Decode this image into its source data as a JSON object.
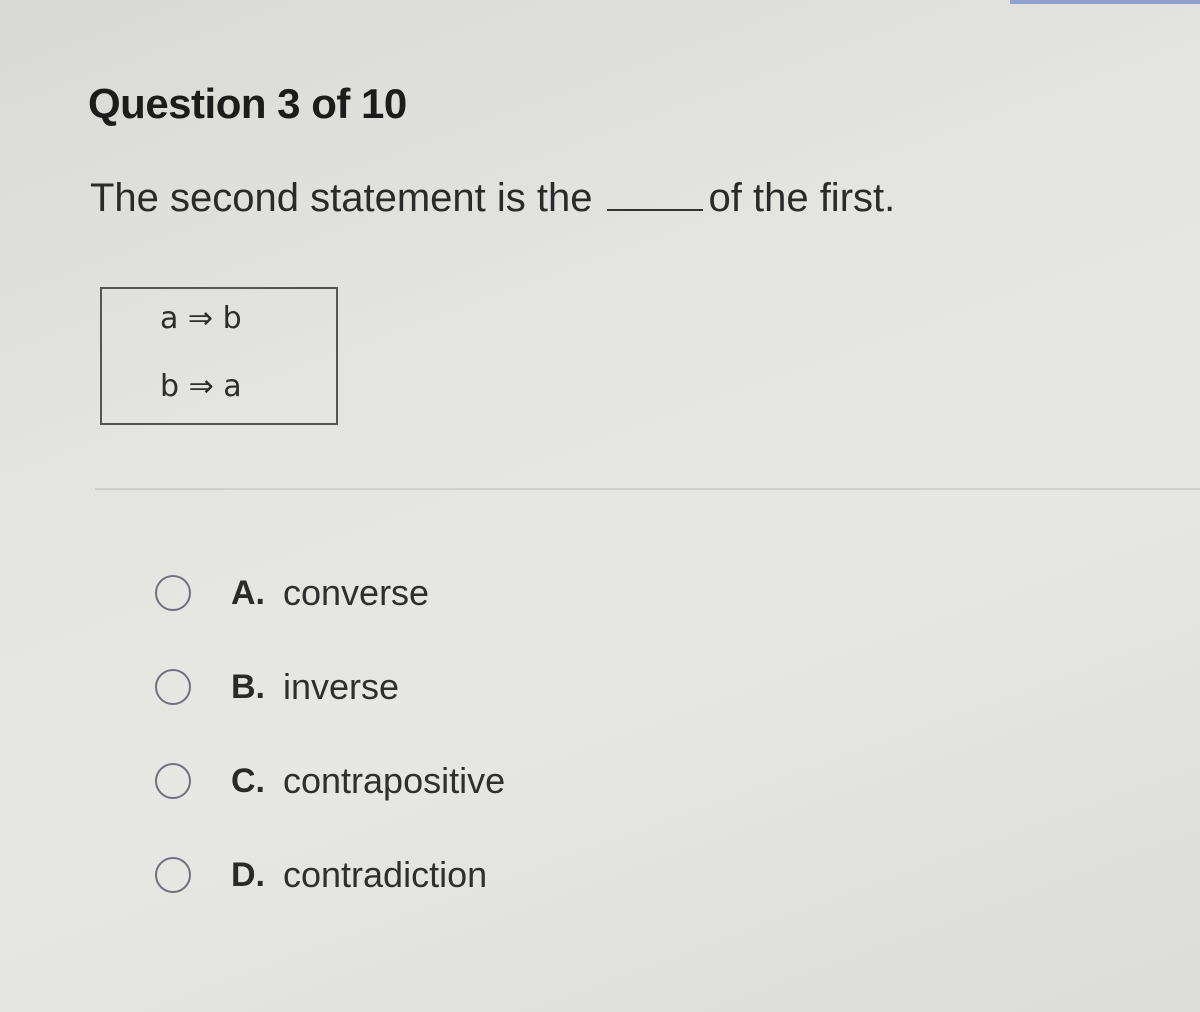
{
  "quiz": {
    "header": "Question 3 of 10",
    "prompt_before": "The second statement is the",
    "prompt_after": "of the first."
  },
  "statements": [
    "a ⇒ b",
    "b ⇒ a"
  ],
  "options": [
    {
      "letter": "A.",
      "text": "converse"
    },
    {
      "letter": "B.",
      "text": "inverse"
    },
    {
      "letter": "C.",
      "text": "contrapositive"
    },
    {
      "letter": "D.",
      "text": "contradiction"
    }
  ]
}
